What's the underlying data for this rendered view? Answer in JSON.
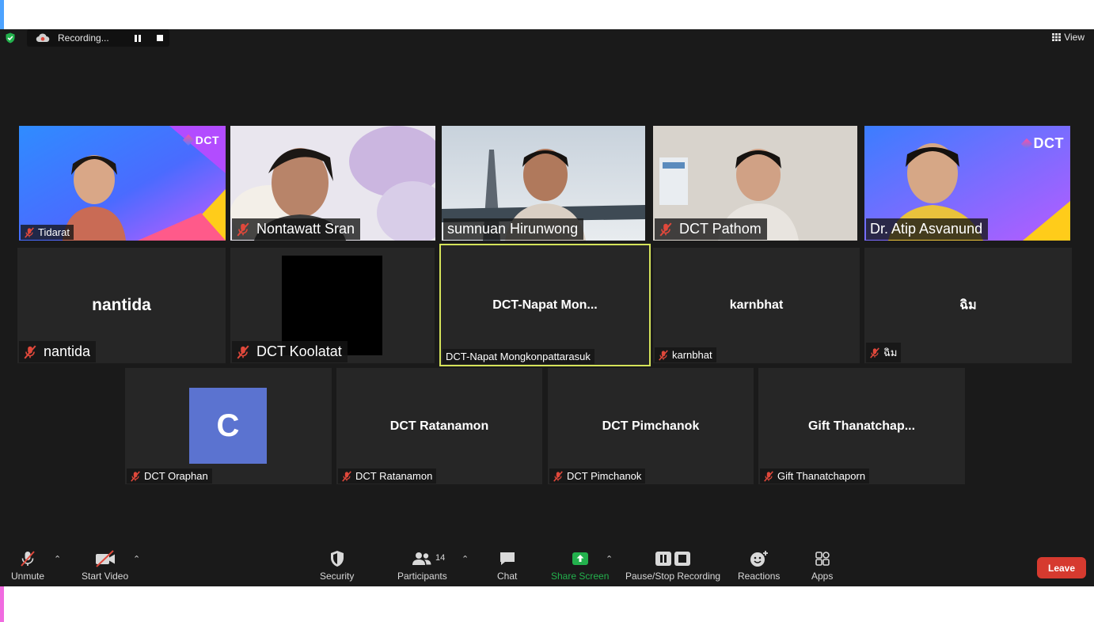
{
  "top_bar": {
    "recording_label": "Recording...",
    "view_label": "View"
  },
  "logo_text": "DCT",
  "tiles": [
    {
      "name": "Tidarat"
    },
    {
      "name": "Nontawatt Sran"
    },
    {
      "name": "sumnuan Hirunwong"
    },
    {
      "name": "DCT Pathom"
    },
    {
      "name": "Dr. Atip Asvanund"
    },
    {
      "name": "nantida",
      "display": "nantida"
    },
    {
      "name": "DCT Koolatat"
    },
    {
      "name": "DCT-Napat Mongkonpattarasuk",
      "display": "DCT-Napat  Mon..."
    },
    {
      "name": "karnbhat",
      "display": "karnbhat"
    },
    {
      "name": "ฉิม",
      "display": "ฉิม"
    },
    {
      "name": "DCT Oraphan",
      "avatar_letter": "C"
    },
    {
      "name": "DCT Ratanamon",
      "display": "DCT Ratanamon"
    },
    {
      "name": "DCT Pimchanok",
      "display": "DCT Pimchanok"
    },
    {
      "name": "Gift Thanatchaporn",
      "display": "Gift  Thanatchap..."
    }
  ],
  "toolbar": {
    "unmute": "Unmute",
    "start_video": "Start Video",
    "security": "Security",
    "participants": "Participants",
    "participant_count": "14",
    "chat": "Chat",
    "share_screen": "Share Screen",
    "pause_stop_recording": "Pause/Stop Recording",
    "reactions": "Reactions",
    "apps": "Apps",
    "leave": "Leave"
  },
  "colors": {
    "meeting_bg": "#1a1a1a",
    "tile_bg": "#262626",
    "active_speaker": "#d5e35a",
    "share_screen": "#23b14d",
    "leave": "#d63a2f",
    "mic_off": "#e0483b",
    "avatar": "#5b73d0"
  }
}
